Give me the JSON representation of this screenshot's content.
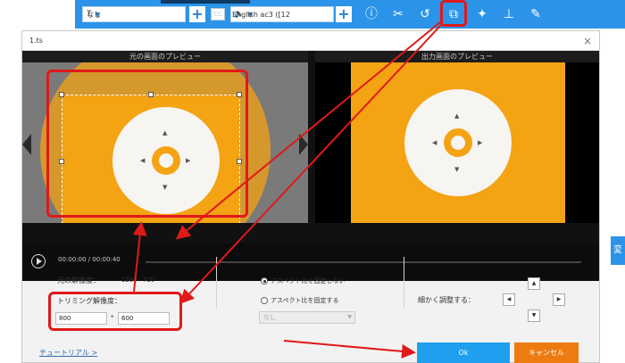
{
  "toolbar": {
    "subtitle_select": "なし",
    "subtitle_icon": "T",
    "audio_select": "English ac3 ([12",
    "plus_label": "+",
    "cc_label": "CC",
    "icons": [
      "info-icon",
      "scissors-icon",
      "rotate-icon",
      "crop-icon",
      "magic-wand-icon",
      "stamp-icon",
      "pencil-icon"
    ]
  },
  "dialog": {
    "title": "1.ts",
    "close": "×",
    "source_preview_label": "元の画面のプレビュー",
    "output_preview_label": "出力画面のプレビュー",
    "time_current": "00:00:00",
    "time_separator": "/",
    "time_total": "00:00:40",
    "original_resolution_label": "元の解像度：",
    "original_width": "1280",
    "original_height": "720",
    "trim_resolution_label": "トリミング解像度：",
    "trim_width": "800",
    "trim_height": "600",
    "times": "*",
    "aspect_unfixed": "アスペクト比を固定しない",
    "aspect_fixed": "アスペクト比を固定する",
    "aspect_select": "なし",
    "fine_adjust_label": "細かく調整する：",
    "tutorial_link": "チュートリアル >",
    "ok_button": "Ok",
    "cancel_button": "キャンセル"
  },
  "side_tab": "変",
  "colors": {
    "toolbar_blue": "#2b94e8",
    "disc_orange": "#f4a313",
    "highlight_red": "#e01919",
    "ok_blue": "#1fa0ee",
    "cancel_orange": "#ee7b12"
  }
}
